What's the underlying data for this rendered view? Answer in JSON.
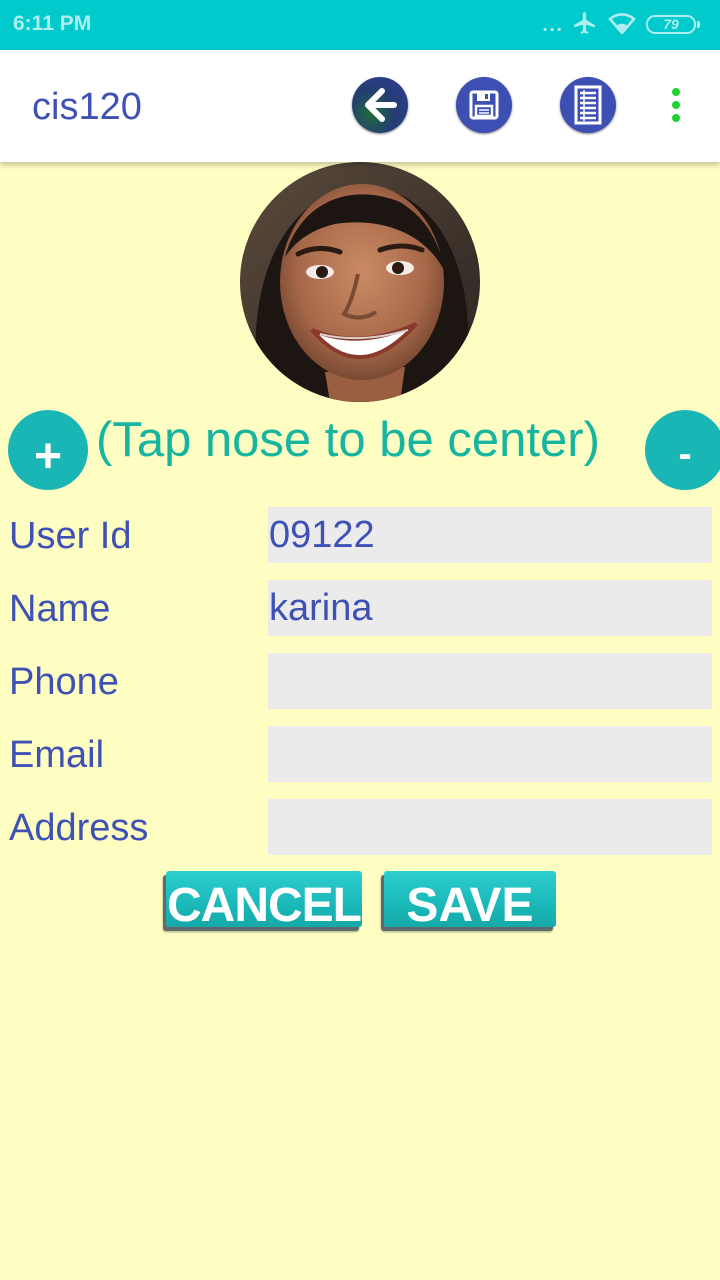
{
  "status_bar": {
    "time": "6:11 PM",
    "signal_dots": "...",
    "battery": "79",
    "icons": [
      "airplane-icon",
      "wifi-icon",
      "battery-icon"
    ]
  },
  "app_bar": {
    "title": "cis120",
    "actions": [
      "back-arrow-icon",
      "save-floppy-icon",
      "list-icon",
      "overflow-menu-icon"
    ]
  },
  "profile": {
    "photo": "avatar-photo"
  },
  "zoom": {
    "plus_label": "+",
    "minus_label": "-",
    "hint": "(Tap nose to be center)"
  },
  "form": {
    "user_id": {
      "label": "User Id",
      "value": "09122"
    },
    "name": {
      "label": "Name",
      "value": "karina"
    },
    "phone": {
      "label": "Phone",
      "value": ""
    },
    "email": {
      "label": "Email",
      "value": ""
    },
    "address": {
      "label": "Address",
      "value": ""
    }
  },
  "buttons": {
    "cancel": "CANCEL",
    "save": "SAVE"
  },
  "colors": {
    "status_bar": "#00cacb",
    "background": "#fefdc2",
    "primary_text": "#3f51b5",
    "accent": "#1ab6b6",
    "hint_text": "#16b5a0",
    "field_bg": "#ebebeb",
    "menu_dots": "#1fd32f"
  }
}
